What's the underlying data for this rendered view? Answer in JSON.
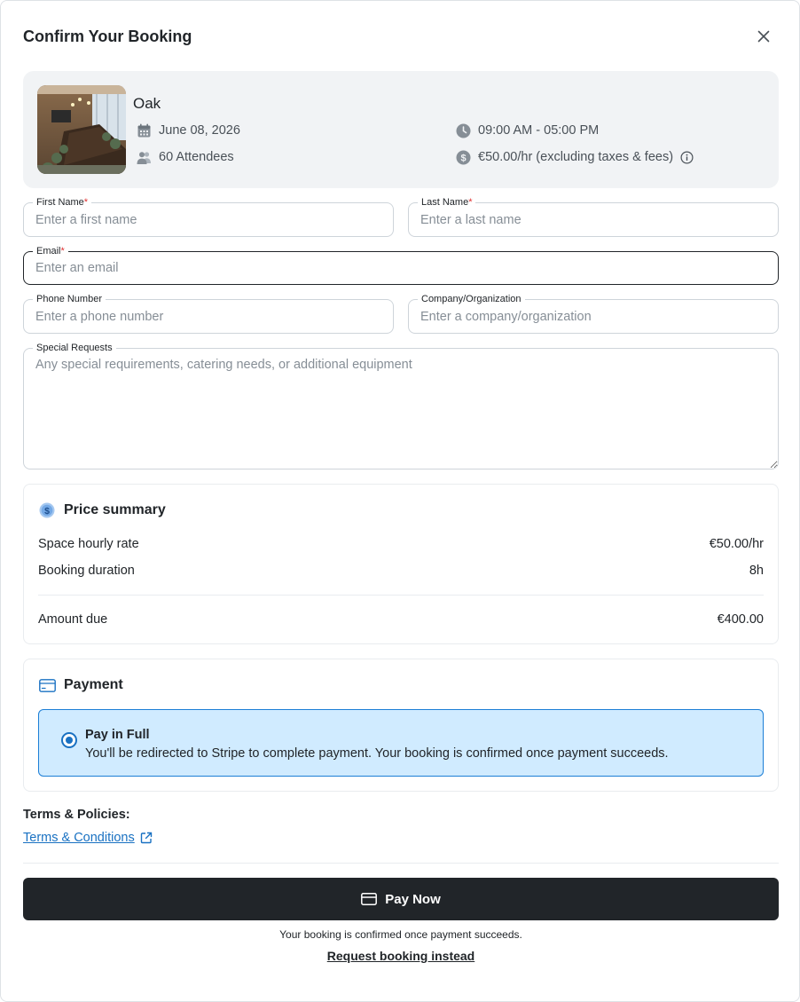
{
  "modal": {
    "title": "Confirm Your Booking",
    "close_icon": "close-icon"
  },
  "space": {
    "name": "Oak",
    "date": "June 08, 2026",
    "time": "09:00 AM - 05:00 PM",
    "attendees": "60 Attendees",
    "rate": "€50.00/hr (excluding taxes & fees)",
    "icons": [
      "calendar-icon",
      "clock-icon",
      "people-icon",
      "dollar-icon",
      "info-icon"
    ]
  },
  "form": {
    "first_name": {
      "label": "First Name",
      "required": "*",
      "placeholder": "Enter a first name",
      "value": ""
    },
    "last_name": {
      "label": "Last Name",
      "required": "*",
      "placeholder": "Enter a last name",
      "value": ""
    },
    "email": {
      "label": "Email",
      "required": "*",
      "placeholder": "Enter an email",
      "value": ""
    },
    "phone": {
      "label": "Phone Number",
      "placeholder": "Enter a phone number",
      "value": ""
    },
    "company": {
      "label": "Company/Organization",
      "placeholder": "Enter a company/organization",
      "value": ""
    },
    "special": {
      "label": "Special Requests",
      "placeholder": "Any special requirements, catering needs, or additional equipment",
      "value": ""
    }
  },
  "price_summary": {
    "title": "Price summary",
    "rows": [
      {
        "label": "Space hourly rate",
        "value": "€50.00/hr"
      },
      {
        "label": "Booking duration",
        "value": "8h"
      }
    ],
    "total": {
      "label": "Amount due",
      "value": "€400.00"
    }
  },
  "payment": {
    "title": "Payment",
    "option": {
      "title": "Pay in Full",
      "description": "You'll be redirected to Stripe to complete payment. Your booking is confirmed once payment succeeds.",
      "selected": true
    }
  },
  "terms": {
    "title": "Terms & Policies:",
    "link": "Terms & Conditions"
  },
  "actions": {
    "pay_now": "Pay Now",
    "note": "Your booking is confirmed once payment succeeds.",
    "request": "Request booking instead"
  },
  "colors": {
    "primary_button": "#212529",
    "accent": "#1971c2",
    "option_bg": "#d0ebff",
    "card_bg": "#f1f3f5"
  }
}
